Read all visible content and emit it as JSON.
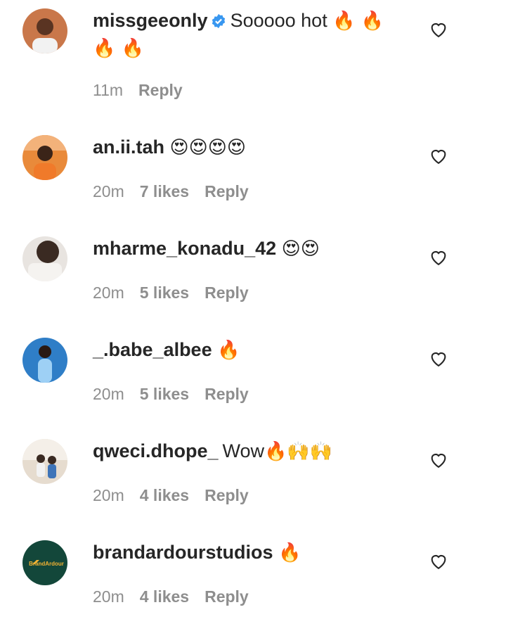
{
  "comments": [
    {
      "username": "missgeeonly",
      "verified": true,
      "text": "Sooooo hot",
      "emoji_inline": "🔥 🔥",
      "emoji_wrap": "🔥 🔥",
      "time": "11m",
      "likes": "",
      "reply": "Reply",
      "avatar_color": "#c9774a",
      "avatar_icon": "profile-photo"
    },
    {
      "username": "an.ii.tah",
      "verified": false,
      "text": "",
      "emoji_inline": "😍😍😍😍",
      "emoji_wrap": "",
      "time": "20m",
      "likes": "7 likes",
      "reply": "Reply",
      "avatar_color": "#e98a3a",
      "avatar_icon": "profile-photo"
    },
    {
      "username": "mharme_konadu_42",
      "verified": false,
      "text": "",
      "emoji_inline": "😍😍",
      "emoji_wrap": "",
      "time": "20m",
      "likes": "5 likes",
      "reply": "Reply",
      "avatar_color": "#8a6a5c",
      "avatar_icon": "profile-photo"
    },
    {
      "username": "_.babe_albee",
      "verified": false,
      "text": "",
      "emoji_inline": "🔥",
      "emoji_wrap": "",
      "time": "20m",
      "likes": "5 likes",
      "reply": "Reply",
      "avatar_color": "#2f7ec7",
      "avatar_icon": "profile-photo"
    },
    {
      "username": "qweci.dhope_",
      "verified": false,
      "text": "Wow",
      "emoji_inline": "🔥🙌🙌",
      "emoji_wrap": "",
      "time": "20m",
      "likes": "4 likes",
      "reply": "Reply",
      "avatar_color": "#d8c8b8",
      "avatar_icon": "profile-photo"
    },
    {
      "username": "brandardourstudios",
      "verified": false,
      "text": "",
      "emoji_inline": "🔥",
      "emoji_wrap": "",
      "time": "20m",
      "likes": "4 likes",
      "reply": "Reply",
      "avatar_color": "#13473a",
      "avatar_icon": "brand-logo",
      "avatar_text": "BrandArdour"
    }
  ],
  "colors": {
    "text": "#262626",
    "muted": "#8e8e8e",
    "verified": "#3897f0"
  },
  "icons": {
    "like": "heart-outline-icon",
    "verified": "verified-badge-icon"
  }
}
